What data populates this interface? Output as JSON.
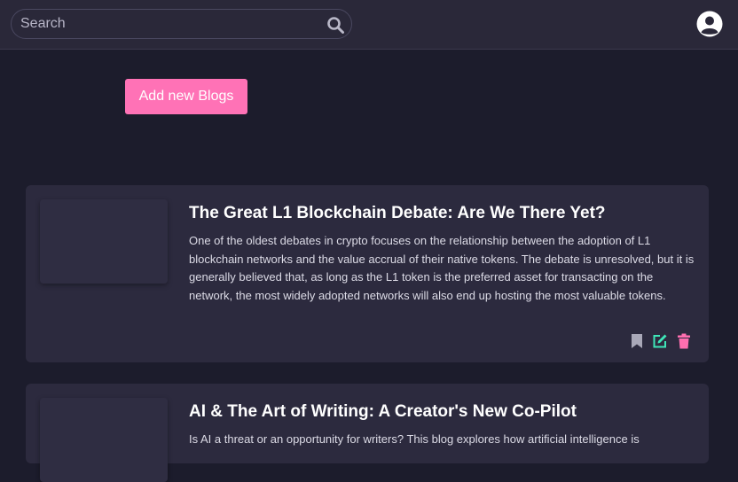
{
  "search": {
    "placeholder": "Search",
    "value": ""
  },
  "main": {
    "add_button_label": "Add new Blogs"
  },
  "posts": [
    {
      "title": "The Great L1 Blockchain Debate: Are We There Yet?",
      "excerpt": "One of the oldest debates in crypto focuses on the relationship between the adoption of L1 blockchain networks and the value accrual of their native tokens. The debate is unresolved, but it is generally believed that, as long as the L1 token is the preferred asset for transacting on the network, the most widely adopted networks will also end up hosting the most valuable tokens."
    },
    {
      "title": "AI & The Art of Writing: A Creator's New Co-Pilot",
      "excerpt": "Is AI a threat or an opportunity for writers? This blog explores how artificial intelligence is"
    }
  ],
  "icons": {
    "search": "search-icon",
    "avatar": "user-circle-icon",
    "bookmark": "bookmark-icon",
    "edit": "edit-icon",
    "delete": "trash-icon"
  },
  "colors": {
    "accent": "#ff72b6",
    "edit": "#3ee6b8",
    "bookmark": "#a9a8b8",
    "delete": "#ff6fb0"
  }
}
